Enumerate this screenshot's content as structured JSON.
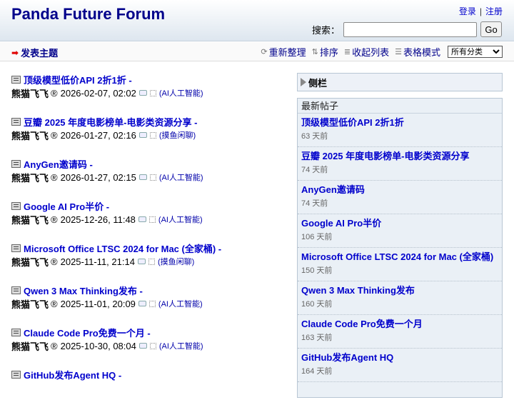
{
  "header": {
    "title": "Panda Future Forum",
    "login": "登录",
    "auth_sep": "|",
    "register": "注册",
    "search_label": "搜索：",
    "search_value": "",
    "go_label": "Go"
  },
  "toolbar": {
    "post_topic": "发表主题",
    "refresh": "重新整理",
    "sort": "排序",
    "collapse": "收起列表",
    "table_mode": "表格模式",
    "category_selected": "所有分类"
  },
  "threads": [
    {
      "title": "顶级模型低价API 2折1折 -",
      "author": "熊猫飞飞",
      "reg": "®",
      "date": "2026-02-07, 02:02",
      "category": "(AI人工智能)"
    },
    {
      "title": "豆瓣 2025 年度电影榜单-电影类资源分享 -",
      "author": "熊猫飞飞",
      "reg": "®",
      "date": "2026-01-27, 02:16",
      "category": "(摸鱼闲聊)"
    },
    {
      "title": "AnyGen邀请码 -",
      "author": "熊猫飞飞",
      "reg": "®",
      "date": "2026-01-27, 02:15",
      "category": "(AI人工智能)"
    },
    {
      "title": "Google AI Pro半价 -",
      "author": "熊猫飞飞",
      "reg": "®",
      "date": "2025-12-26, 11:48",
      "category": "(AI人工智能)"
    },
    {
      "title": "Microsoft Office LTSC 2024 for Mac (全家桶) -",
      "author": "熊猫飞飞",
      "reg": "®",
      "date": "2025-11-11, 21:14",
      "category": "(摸鱼闲聊)"
    },
    {
      "title": "Qwen 3 Max Thinking发布 -",
      "author": "熊猫飞飞",
      "reg": "®",
      "date": "2025-11-01, 20:09",
      "category": "(AI人工智能)"
    },
    {
      "title": "Claude Code Pro免费一个月 -",
      "author": "熊猫飞飞",
      "reg": "®",
      "date": "2025-10-30, 08:04",
      "category": "(AI人工智能)"
    },
    {
      "title": "GitHub发布Agent HQ -",
      "author": "熊猫飞飞",
      "reg": "®",
      "date": "",
      "category": ""
    }
  ],
  "sidebar": {
    "title": "侧栏",
    "box_title": "最新帖子",
    "recent": [
      {
        "title": "顶级模型低价API 2折1折",
        "age": "63 天前"
      },
      {
        "title": "豆瓣 2025 年度电影榜单-电影类资源分享",
        "age": "74 天前"
      },
      {
        "title": "AnyGen邀请码",
        "age": "74 天前"
      },
      {
        "title": "Google AI Pro半价",
        "age": "106 天前"
      },
      {
        "title": "Microsoft Office LTSC 2024 for Mac (全家桶)",
        "age": "150 天前"
      },
      {
        "title": "Qwen 3 Max Thinking发布",
        "age": "160 天前"
      },
      {
        "title": "Claude Code Pro免费一个月",
        "age": "163 天前"
      },
      {
        "title": "GitHub发布Agent HQ",
        "age": "164 天前"
      }
    ]
  },
  "colors": {
    "link": "#0000cc",
    "title": "#00008b",
    "accent_arrow": "#e00000"
  }
}
